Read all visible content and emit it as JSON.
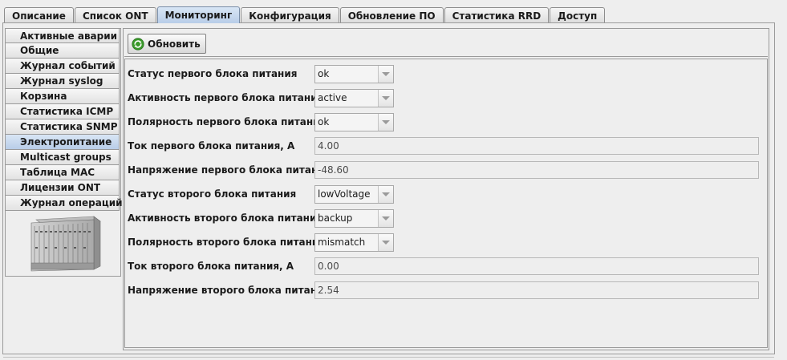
{
  "tabs": [
    {
      "label": "Описание",
      "active": false
    },
    {
      "label": "Список ONT",
      "active": false
    },
    {
      "label": "Мониторинг",
      "active": true
    },
    {
      "label": "Конфигурация",
      "active": false
    },
    {
      "label": "Обновление ПО",
      "active": false
    },
    {
      "label": "Статистика RRD",
      "active": false
    },
    {
      "label": "Доступ",
      "active": false
    }
  ],
  "sidebar": {
    "items": [
      {
        "label": "Активные аварии",
        "selected": false
      },
      {
        "label": "Общие",
        "selected": false
      },
      {
        "label": "Журнал событий",
        "selected": false
      },
      {
        "label": "Журнал syslog",
        "selected": false
      },
      {
        "label": "Корзина",
        "selected": false
      },
      {
        "label": "Статистика ICMP",
        "selected": false
      },
      {
        "label": "Статистика SNMP",
        "selected": false
      },
      {
        "label": "Электропитание",
        "selected": true
      },
      {
        "label": "Multicast groups",
        "selected": false
      },
      {
        "label": "Таблица MAC",
        "selected": false
      },
      {
        "label": "Лицензии ONT",
        "selected": false
      },
      {
        "label": "Журнал операций",
        "selected": false
      }
    ]
  },
  "toolbar": {
    "refresh_label": "Обновить",
    "refresh_icon": "refresh-icon"
  },
  "power": {
    "psu1_status_label": "Статус первого блока питания",
    "psu1_status_value": "ok",
    "psu1_activity_label": "Активность первого блока питания",
    "psu1_activity_value": "active",
    "psu1_polarity_label": "Полярность первого блока питания",
    "psu1_polarity_value": "ok",
    "psu1_current_label": "Ток первого блока питания, A",
    "psu1_current_value": "4.00",
    "psu1_voltage_label": "Напряжение первого блока питания, V",
    "psu1_voltage_value": "-48.60",
    "psu2_status_label": "Статус второго блока питания",
    "psu2_status_value": "lowVoltage",
    "psu2_activity_label": "Активность второго блока питания",
    "psu2_activity_value": "backup",
    "psu2_polarity_label": "Полярность второго блока питания",
    "psu2_polarity_value": "mismatch",
    "psu2_current_label": "Ток второго блока питания, A",
    "psu2_current_value": "0.00",
    "psu2_voltage_label": "Напряжение второго блока питания, V",
    "psu2_voltage_value": "2.54"
  },
  "colors": {
    "background": "#eeeeee",
    "active_tab": "#b8cde8",
    "border": "#9a9a9a",
    "refresh_icon_green": "#3a9a2a"
  }
}
